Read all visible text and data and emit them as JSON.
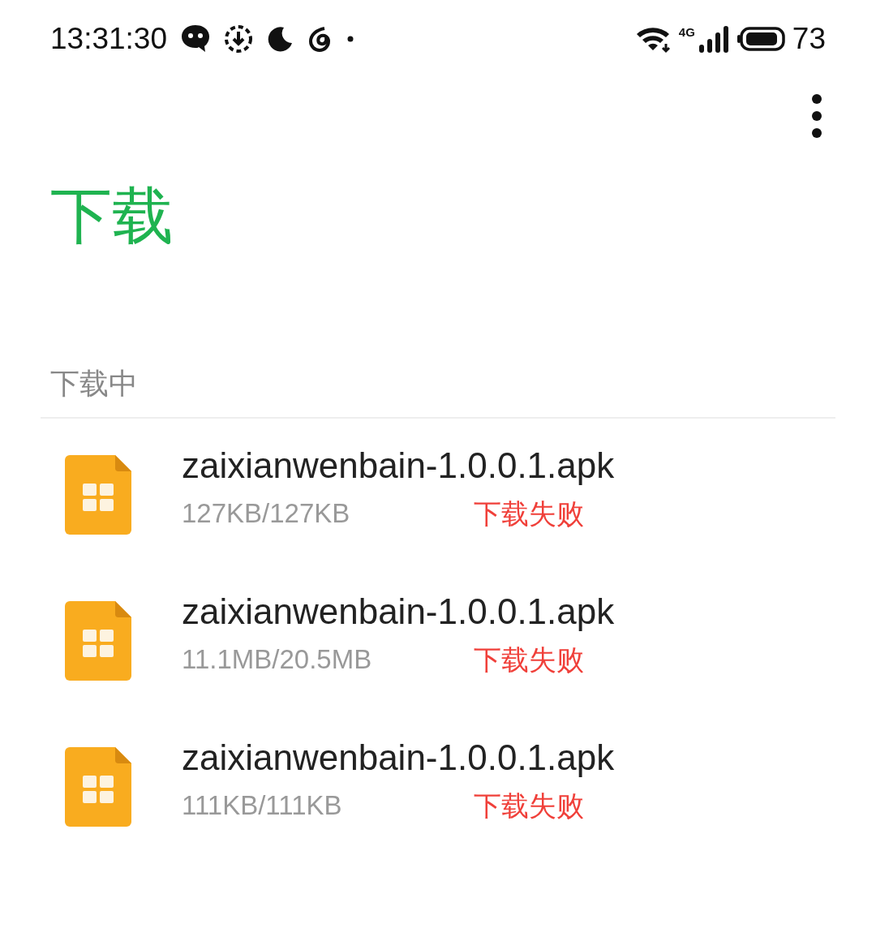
{
  "status_bar": {
    "time": "13:31:30",
    "network": "4G",
    "battery": "73"
  },
  "title": "下载",
  "section": {
    "title": "下载中"
  },
  "downloads": [
    {
      "name": "zaixianwenbain-1.0.0.1.apk",
      "size": "127KB/127KB",
      "status": "下载失败",
      "failed": true
    },
    {
      "name": "zaixianwenbain-1.0.0.1.apk",
      "size": "11.1MB/20.5MB",
      "status": "下载失败",
      "failed": true
    },
    {
      "name": "zaixianwenbain-1.0.0.1.apk",
      "size": "111KB/111KB",
      "status": "下载失败",
      "failed": true
    }
  ]
}
